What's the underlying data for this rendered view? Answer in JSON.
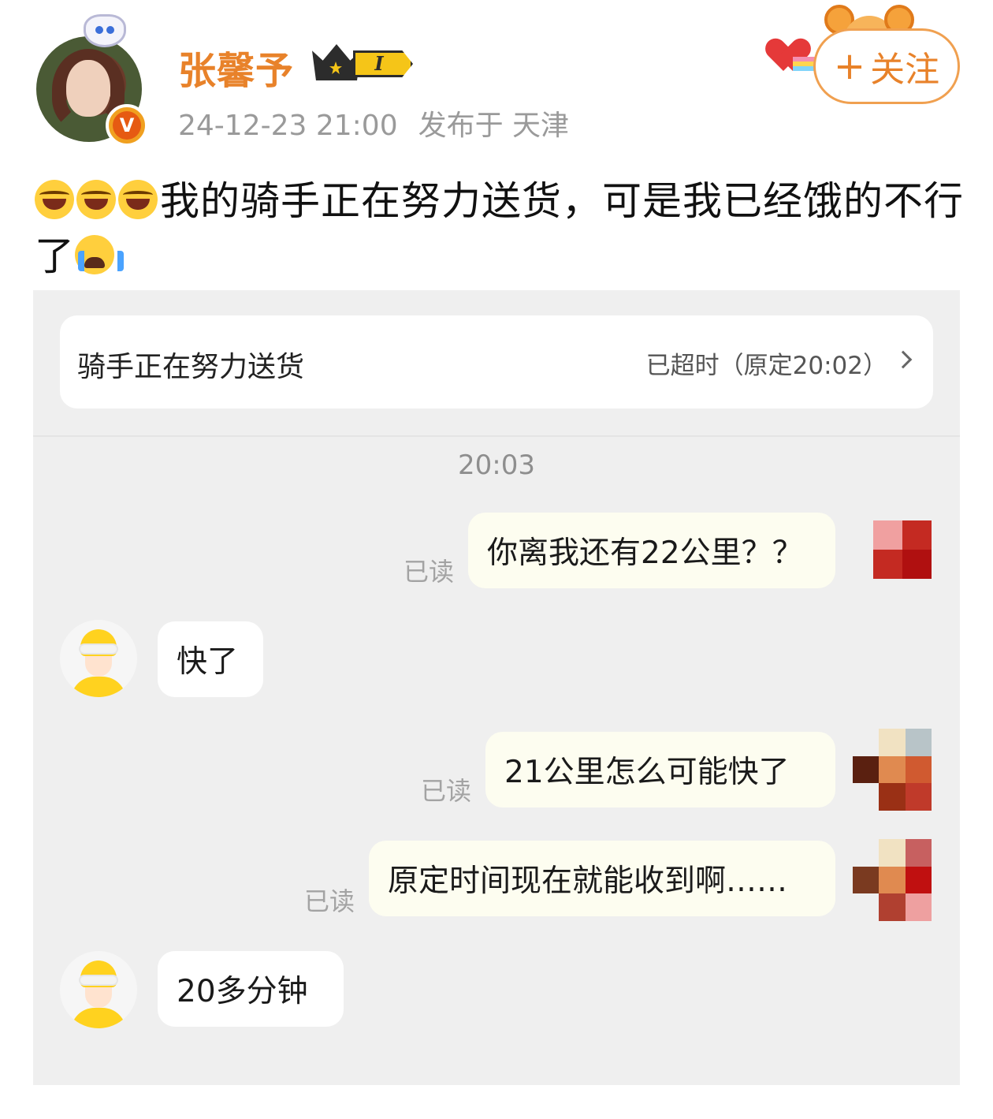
{
  "post": {
    "username": "张馨予",
    "vip_level": "I",
    "verified_badge": "V",
    "date": "24-12-23 21:00",
    "location": "发布于 天津",
    "follow_label": "关注",
    "follow_prefix": "+",
    "text_main": "我的骑手正在努力送货，可是我已经饿的不行了",
    "emojis": [
      "laugh-cry-emoji",
      "laugh-cry-emoji",
      "laugh-cry-emoji",
      "crying-emoji"
    ],
    "accent_color": "#e8822a"
  },
  "chat": {
    "status_title": "骑手正在努力送货",
    "status_right": "已超时（原定20:02）",
    "timestamp": "20:03",
    "read_label": "已读",
    "messages": [
      {
        "from": "me",
        "text": "你离我还有22公里？？",
        "read": true
      },
      {
        "from": "rider",
        "text": "快了"
      },
      {
        "from": "me",
        "text": "21公里怎么可能快了",
        "read": true
      },
      {
        "from": "me",
        "text": "原定时间现在就能收到啊……",
        "read": true
      },
      {
        "from": "rider",
        "text": "20多分钟"
      }
    ]
  },
  "icons": {
    "avatar": "user-avatar",
    "rider_avatar": "rider-avatar",
    "my_avatar": "pixelated-avatar",
    "chevron": "chevron-right-icon"
  }
}
